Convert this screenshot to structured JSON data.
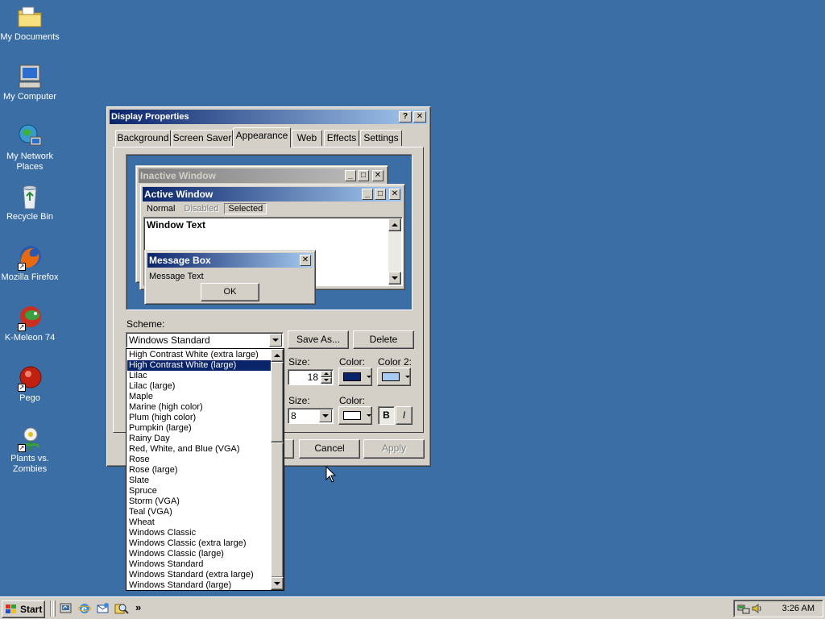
{
  "desktop": {
    "icons": [
      {
        "label": "My Documents",
        "icon": "folder-documents-icon"
      },
      {
        "label": "My Computer",
        "icon": "computer-icon"
      },
      {
        "label": "My Network Places",
        "icon": "network-places-icon"
      },
      {
        "label": "Recycle Bin",
        "icon": "recycle-bin-icon"
      },
      {
        "label": "Mozilla Firefox",
        "icon": "firefox-icon"
      },
      {
        "label": "K-Meleon 74",
        "icon": "k-meleon-icon"
      },
      {
        "label": "Pego",
        "icon": "pego-icon"
      },
      {
        "label": "Plants vs. Zombies",
        "icon": "plants-vs-zombies-icon"
      }
    ],
    "background_color": "#3a6ea5"
  },
  "dialog": {
    "title": "Display Properties",
    "help_glyph": "?",
    "close_glyph": "✕",
    "tabs": [
      "Background",
      "Screen Saver",
      "Appearance",
      "Web",
      "Effects",
      "Settings"
    ],
    "active_tab": "Appearance",
    "preview": {
      "inactive_title": "Inactive Window",
      "active_title": "Active Window",
      "menu": [
        "Normal",
        "Disabled",
        "Selected"
      ],
      "window_text": "Window Text",
      "msgbox_title": "Message Box",
      "msgbox_text": "Message Text",
      "ok_label": "OK"
    },
    "scheme": {
      "label": "Scheme:",
      "value": "Windows Standard",
      "save_as_label": "Save As...",
      "delete_label": "Delete",
      "list": [
        "High Contrast White (extra large)",
        "High Contrast White (large)",
        "Lilac",
        "Lilac (large)",
        "Maple",
        "Marine (high color)",
        "Plum (high color)",
        "Pumpkin (large)",
        "Rainy Day",
        "Red, White, and Blue (VGA)",
        "Rose",
        "Rose (large)",
        "Slate",
        "Spruce",
        "Storm (VGA)",
        "Teal (VGA)",
        "Wheat",
        "Windows Classic",
        "Windows Classic (extra large)",
        "Windows Classic (large)",
        "Windows Standard",
        "Windows Standard (extra large)",
        "Windows Standard (large)"
      ],
      "selected_item": "High Contrast White (large)"
    },
    "item": {
      "size_label": "Size:",
      "size_value": "18",
      "color_label": "Color:",
      "color2_label": "Color 2:",
      "color1_value": "#0a246a",
      "color2_value": "#a6caf0"
    },
    "font": {
      "size_label": "Size:",
      "size_value": "8",
      "color_label": "Color:",
      "color_value": "#ffffff",
      "bold_label": "B",
      "italic_label": "I"
    },
    "buttons": {
      "cancel": "Cancel",
      "apply": "Apply"
    }
  },
  "taskbar": {
    "start_label": "Start",
    "quick_launch": [
      "show-desktop-icon",
      "internet-explorer-icon",
      "outlook-express-icon",
      "search-icon"
    ],
    "chevron": "»",
    "clock": "3:26 AM"
  }
}
